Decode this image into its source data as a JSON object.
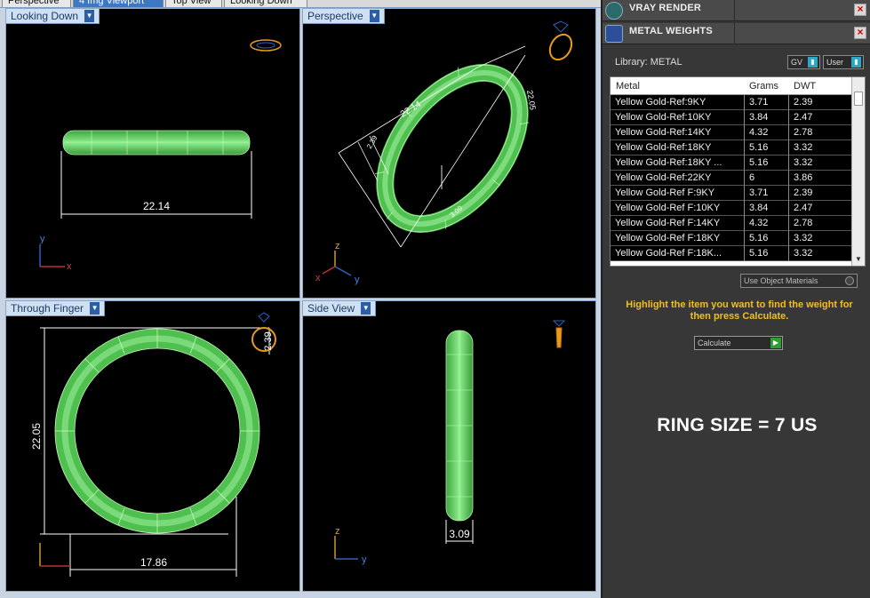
{
  "tabs": [
    {
      "label": "Perspective",
      "active": false
    },
    {
      "label": "4 Img Viewport",
      "active": true
    },
    {
      "label": "Top View",
      "active": false
    },
    {
      "label": "Looking Down",
      "active": false
    }
  ],
  "viewports": {
    "top_left": {
      "label": "Looking Down",
      "dimension": "22.14",
      "axis_y": "y",
      "axis_x": "x"
    },
    "top_right": {
      "label": "Perspective",
      "dimension_a": "22.14",
      "dimension_b": "22.05",
      "dimension_c": "2.39",
      "dimension_d": "3.09",
      "axis_z": "z",
      "axis_x": "x",
      "axis_y": "y"
    },
    "bottom_left": {
      "label": "Through Finger",
      "dimension_height": "22.05",
      "dimension_width": "17.86",
      "dimension_thickness": "2.39"
    },
    "bottom_right": {
      "label": "Side View",
      "dimension_width": "3.09",
      "axis_z": "z",
      "axis_y": "y"
    }
  },
  "panel": {
    "rollout_vray": "VRAY RENDER",
    "rollout_metal": "METAL WEIGHTS",
    "library_label": "Library: METAL",
    "dropdown_gv": "GV",
    "dropdown_user": "User",
    "table": {
      "headers": [
        "Metal",
        "Grams",
        "DWT"
      ],
      "rows": [
        {
          "metal": "Yellow Gold-Ref:9KY",
          "grams": "3.71",
          "dwt": "2.39"
        },
        {
          "metal": "Yellow Gold-Ref:10KY",
          "grams": "3.84",
          "dwt": "2.47"
        },
        {
          "metal": "Yellow Gold-Ref:14KY",
          "grams": "4.32",
          "dwt": "2.78"
        },
        {
          "metal": "Yellow Gold-Ref:18KY",
          "grams": "5.16",
          "dwt": "3.32"
        },
        {
          "metal": "Yellow Gold-Ref:18KY ...",
          "grams": "5.16",
          "dwt": "3.32"
        },
        {
          "metal": "Yellow Gold-Ref:22KY",
          "grams": "6",
          "dwt": "3.86"
        },
        {
          "metal": "Yellow Gold-Ref F:9KY",
          "grams": "3.71",
          "dwt": "2.39"
        },
        {
          "metal": "Yellow Gold-Ref F:10KY",
          "grams": "3.84",
          "dwt": "2.47"
        },
        {
          "metal": "Yellow Gold-Ref F:14KY",
          "grams": "4.32",
          "dwt": "2.78"
        },
        {
          "metal": "Yellow Gold-Ref F:18KY",
          "grams": "5.16",
          "dwt": "3.32"
        },
        {
          "metal": "Yellow Gold-Ref F:18K...",
          "grams": "5.16",
          "dwt": "3.32"
        }
      ]
    },
    "use_object_materials": "Use Object Materials",
    "instruction": "Highlight the item you want to find the weight for then press Calculate.",
    "calculate_label": "Calculate",
    "ring_size": "RING SIZE = 7 US"
  },
  "colors": {
    "ring_green": "#5fd35f",
    "ring_wire": "#b8f5a8",
    "dimension_line": "#ffffff",
    "instruction_text": "#f0c020",
    "viewport_bg": "#000000",
    "axis_x": "#c03030",
    "axis_y": "#3060c0",
    "axis_z": "#c89a30"
  }
}
